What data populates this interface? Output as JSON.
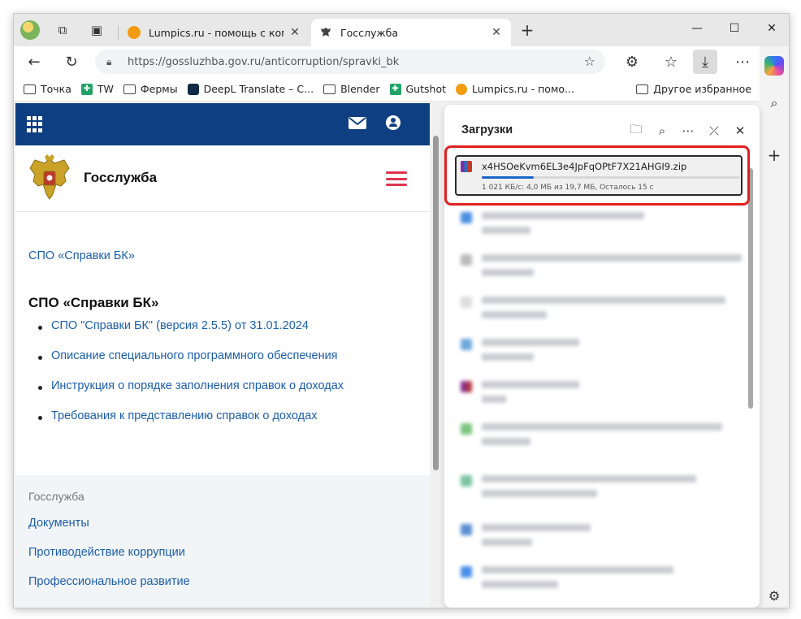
{
  "browser": {
    "tabs": [
      {
        "title": "Lumpics.ru - помощь с компьютером",
        "active": false
      },
      {
        "title": "Госслужба",
        "active": true
      }
    ],
    "new_tab": "+",
    "url": "https://gossluzhba.gov.ru/anticorruption/spravki_bk",
    "window_controls": {
      "minimize": "—",
      "maximize": "☐",
      "close": "✕"
    }
  },
  "bookmarks": [
    {
      "label": "Точка",
      "icon": "folder-icon"
    },
    {
      "label": "TW",
      "icon": "sheets-icon"
    },
    {
      "label": "Фермы",
      "icon": "folder-icon"
    },
    {
      "label": "DeepL Translate – С...",
      "icon": "deepl-icon"
    },
    {
      "label": "Blender",
      "icon": "folder-icon"
    },
    {
      "label": "Gutshot",
      "icon": "sheets-icon"
    },
    {
      "label": "Lumpics.ru - помо...",
      "icon": "lumpics-icon"
    }
  ],
  "bookmarks_other": "Другое избранное",
  "site": {
    "brand": "Госслужба",
    "breadcrumb": "СПО «Справки БК»",
    "heading": "СПО «Справки БК»",
    "links": [
      "СПО \"Справки БК\" (версия 2.5.5) от 31.01.2024",
      "Описание специального программного обеспечения",
      "Инструкция о порядке заполнения справок о доходах",
      "Требования к представлению справок о доходах"
    ],
    "footer": {
      "title": "Госслужба",
      "links": [
        "Документы",
        "Противодействие коррупции",
        "Профессиональное развитие"
      ]
    }
  },
  "downloads": {
    "title": "Загрузки",
    "current": {
      "filename": "x4HSOeKvm6EL3e4JpFqOPtF7X21AHGI9.zip",
      "progress": 0.2,
      "status": "1 021 КБ/с: 4,0 МБ из 19,7 МБ, Осталось 15 с"
    }
  },
  "colors": {
    "site_header": "#0d3f82",
    "link": "#1b5dab",
    "burger": "#e0334d",
    "progress": "#1a66c9",
    "highlight": "#e12020"
  }
}
